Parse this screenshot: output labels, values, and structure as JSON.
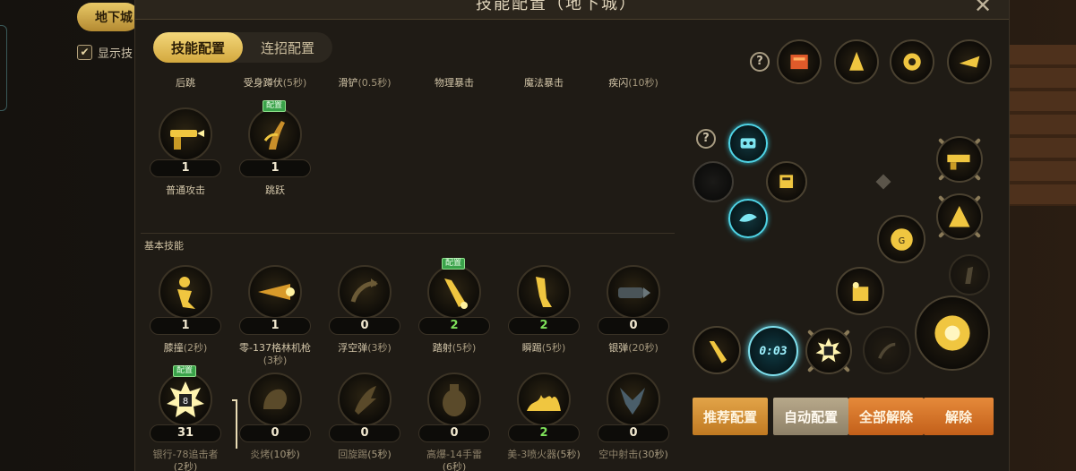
{
  "background": {
    "tag_label": "地下城",
    "checkbox_label": "显示技"
  },
  "dialog": {
    "title": "技能配置（地下城）",
    "tabs": [
      {
        "label": "技能配置",
        "active": true
      },
      {
        "label": "连招配置",
        "active": false
      }
    ]
  },
  "top_labels": [
    {
      "name": "后跳",
      "sub": ""
    },
    {
      "name": "受身蹲伏",
      "sub": "(5秒)"
    },
    {
      "name": "滑铲",
      "sub": "(0.5秒)"
    },
    {
      "name": "物理暴击",
      "sub": ""
    },
    {
      "name": "魔法暴击",
      "sub": ""
    },
    {
      "name": "疾闪",
      "sub": "(10秒)"
    }
  ],
  "general_skills": [
    {
      "name": "普通攻击",
      "count": "1",
      "icon": "gun-attack-icon",
      "badge": ""
    },
    {
      "name": "跳跃",
      "count": "1",
      "icon": "jump-icon",
      "badge": "配置"
    }
  ],
  "section_basic": "基本技能",
  "basic_row1": [
    {
      "name": "膝撞",
      "sub": "(2秒)",
      "count": "1",
      "green": false,
      "icon": "knee-strike-icon",
      "badge": ""
    },
    {
      "name": "零-137格林机枪",
      "sub": "(3秒)",
      "count": "1",
      "green": false,
      "icon": "gatling-gun-icon",
      "badge": ""
    },
    {
      "name": "浮空弹",
      "sub": "(3秒)",
      "count": "0",
      "green": false,
      "icon": "float-shot-icon",
      "badge": ""
    },
    {
      "name": "踏射",
      "sub": "(5秒)",
      "count": "2",
      "green": true,
      "icon": "stomp-shot-icon",
      "badge": "配置"
    },
    {
      "name": "瞬踢",
      "sub": "(5秒)",
      "count": "2",
      "green": true,
      "icon": "quick-kick-icon",
      "badge": ""
    },
    {
      "name": "银弹",
      "sub": "(20秒)",
      "count": "0",
      "green": false,
      "icon": "silver-bullet-icon",
      "badge": ""
    }
  ],
  "basic_row2": [
    {
      "name": "银行-78追击者",
      "sub": "(2秒)",
      "count": "31",
      "green": false,
      "icon": "mine-icon",
      "badge": "配置"
    },
    {
      "name": "炎烤",
      "sub": "(10秒)",
      "count": "0",
      "green": false,
      "icon": "flame-beast-icon",
      "badge": ""
    },
    {
      "name": "回旋踢",
      "sub": "(5秒)",
      "count": "0",
      "green": false,
      "icon": "spin-kick-icon",
      "badge": ""
    },
    {
      "name": "高爆-14手雷",
      "sub": "(6秒)",
      "count": "0",
      "green": false,
      "icon": "grenade-icon",
      "badge": ""
    },
    {
      "name": "美-3喷火器",
      "sub": "(5秒)",
      "count": "2",
      "green": true,
      "icon": "flamethrower-icon",
      "badge": ""
    },
    {
      "name": "空中射击",
      "sub": "(30秒)",
      "count": "0",
      "green": false,
      "icon": "air-shot-icon",
      "badge": ""
    }
  ],
  "quick_slot_timer": "0:03",
  "buttons": {
    "recommend": "推荐配置",
    "auto": "自动配置",
    "clear_all": "全部解除",
    "clear": "解除"
  },
  "help_label": "?",
  "colors": {
    "accent_gold": "#d3a83e",
    "count_green": "#7fe25a",
    "timer_cyan": "#59cce0"
  }
}
